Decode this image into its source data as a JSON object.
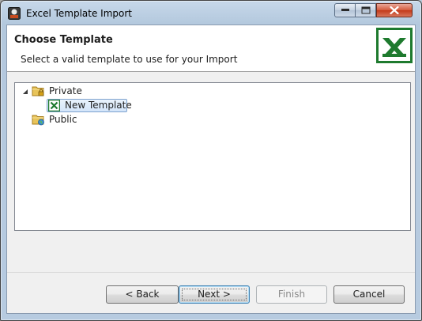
{
  "window": {
    "title": "Excel Template Import",
    "icons": {
      "app": "app-logo-icon",
      "minimize": "minimize-icon",
      "maximize": "maximize-icon",
      "close": "close-icon"
    }
  },
  "header": {
    "title": "Choose Template",
    "subtitle": "Select a valid template to use for your Import",
    "logo_icon": "excel-logo-icon"
  },
  "tree": {
    "nodes": [
      {
        "label": "Private",
        "icon": "folder-lock-icon",
        "expanded": true
      },
      {
        "label": "New Template",
        "icon": "excel-file-icon",
        "selected": true,
        "parent": "Private"
      },
      {
        "label": "Public",
        "icon": "folder-globe-icon",
        "expanded": false
      }
    ]
  },
  "buttons": {
    "back": "< Back",
    "next": "Next >",
    "finish": "Finish",
    "cancel": "Cancel"
  },
  "colors": {
    "excel_green": "#1e7a2e",
    "selection_border": "#7da2ce",
    "default_button_border": "#3c7fb1"
  }
}
